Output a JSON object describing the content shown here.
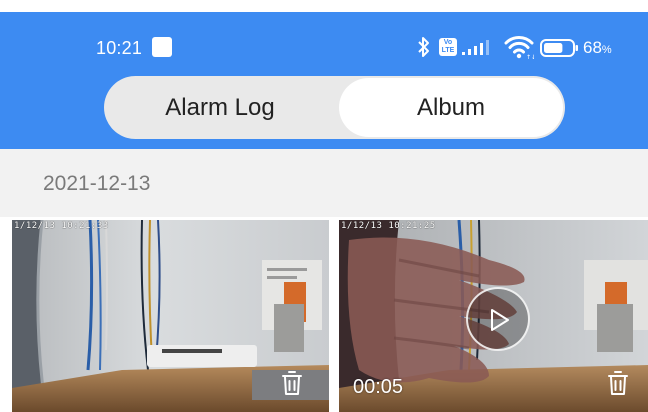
{
  "status_bar": {
    "time": "10:21",
    "volte_label": "Vo LTE",
    "battery_percent": "68",
    "battery_unit": "%",
    "battery_level": 0.68,
    "icons": [
      "notification-square-icon",
      "bluetooth-icon",
      "volte-icon",
      "signal-icon",
      "wifi-icon",
      "battery-icon"
    ]
  },
  "tabs": [
    {
      "label": "Alarm Log",
      "selected": false
    },
    {
      "label": "Album",
      "selected": true
    }
  ],
  "album": {
    "date": "2021-12-13",
    "items": [
      {
        "timestamp": "1/12/13 10:21:33",
        "type": "photo"
      },
      {
        "timestamp": "1/12/13 10:21:25",
        "type": "video",
        "duration": "00:05"
      }
    ]
  },
  "colors": {
    "header": "#3d8bf2",
    "segment_bg": "#e9e9e9",
    "date_bar": "#f2f2f2"
  }
}
